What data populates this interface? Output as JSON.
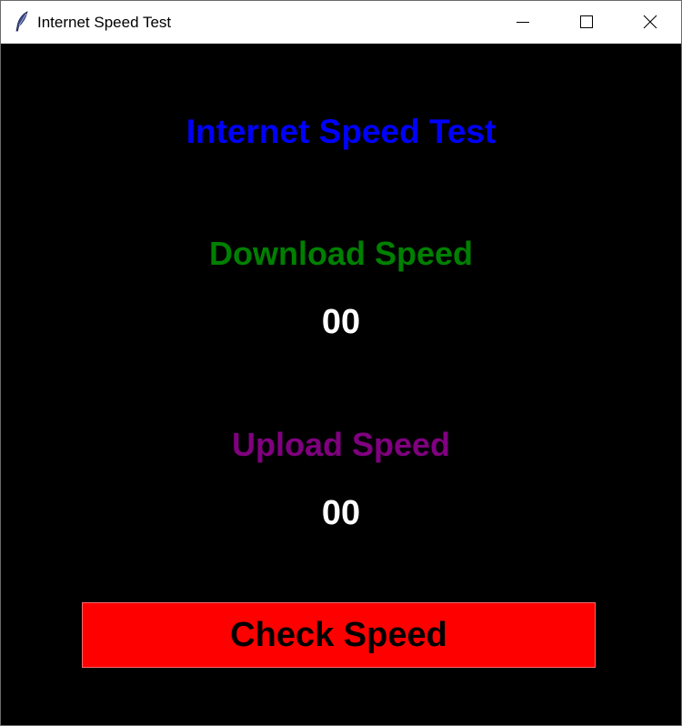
{
  "window": {
    "title": "Internet Speed Test",
    "app_icon": "feather-icon",
    "controls": {
      "minimize_icon": "minimize-icon",
      "maximize_icon": "maximize-icon",
      "close_icon": "close-icon"
    }
  },
  "main": {
    "heading": "Internet Speed Test",
    "download_label": "Download Speed",
    "download_value": "00",
    "upload_label": "Upload Speed",
    "upload_value": "00",
    "check_button_label": "Check Speed"
  },
  "colors": {
    "background": "#000000",
    "heading": "#0000ff",
    "download_label": "#008000",
    "upload_label": "#800080",
    "value": "#ffffff",
    "button_bg": "#ff0000",
    "button_text": "#000000"
  }
}
